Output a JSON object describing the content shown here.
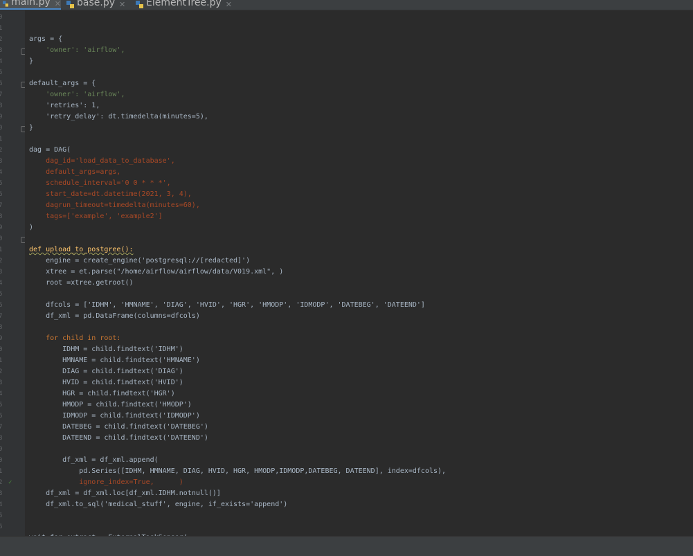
{
  "tabs": [
    {
      "label": "main.py",
      "active": true
    },
    {
      "label": "base.py",
      "active": false
    },
    {
      "label": "ElementTree.py",
      "active": false
    }
  ],
  "gutter": {
    "line_numbers": [
      "0",
      "1",
      "2",
      "3",
      "4",
      "5",
      "6",
      "7",
      "8",
      "9",
      "0",
      "1",
      "2",
      "3",
      "4",
      "5",
      "6",
      "7",
      "8",
      "9",
      "0",
      "1",
      "2",
      "3",
      "4",
      "5",
      "6",
      "7",
      "8",
      "9",
      "0",
      "1",
      "2",
      "3",
      "4",
      "5",
      "6",
      "7",
      "8",
      "9",
      "0",
      "1",
      "2",
      "3",
      "4",
      "5",
      "6"
    ],
    "check_mark": "✓"
  },
  "code": {
    "lines": [
      "",
      "",
      "args = {",
      "    'owner': 'airflow',",
      "}",
      "",
      "default_args = {",
      "    'owner': 'airflow',",
      "    'retries': 1,",
      "    'retry_delay': dt.timedelta(minutes=5),",
      "}",
      "",
      "dag = DAG(",
      "    dag_id='load_data_to_database',",
      "    default_args=args,",
      "    schedule_interval='0 0 * * *',",
      "    start_date=dt.datetime(2021, 3, 4),",
      "    dagrun_timeout=timedelta(minutes=60),",
      "    tags=['example', 'example2']",
      ")",
      "",
      "def upload_to_postgree():",
      "    engine = create_engine('postgresql://[redacted]')",
      "    xtree = et.parse(\"/home/airflow/airflow/data/V019.xml\", )",
      "    root =xtree.getroot()",
      "",
      "    dfcols = ['IDHM', 'HMNAME', 'DIAG', 'HVID', 'HGR', 'HMODP', 'IDMODP', 'DATEBEG', 'DATEEND']",
      "    df_xml = pd.DataFrame(columns=dfcols)",
      "",
      "    for child in root:",
      "        IDHM = child.findtext('IDHM')",
      "        HMNAME = child.findtext('HMNAME')",
      "        DIAG = child.findtext('DIAG')",
      "        HVID = child.findtext('HVID')",
      "        HGR = child.findtext('HGR')",
      "        HMODP = child.findtext('HMODP')",
      "        IDMODP = child.findtext('IDMODP')",
      "        DATEBEG = child.findtext('DATEBEG')",
      "        DATEEND = child.findtext('DATEEND')",
      "",
      "        df_xml = df_xml.append(",
      "            pd.Series([IDHM, HMNAME, DIAG, HVID, HGR, HMODP,IDMODP,DATEBEG, DATEEND], index=dfcols),",
      "            ignore_index=True,      )",
      "    df_xml = df_xml.loc[df_xml.IDHM.notnull()]",
      "    df_xml.to_sql('medical_stuff', engine, if_exists='append')",
      "",
      "",
      "wait_for_extract = ExternalTaskSensor("
    ]
  }
}
